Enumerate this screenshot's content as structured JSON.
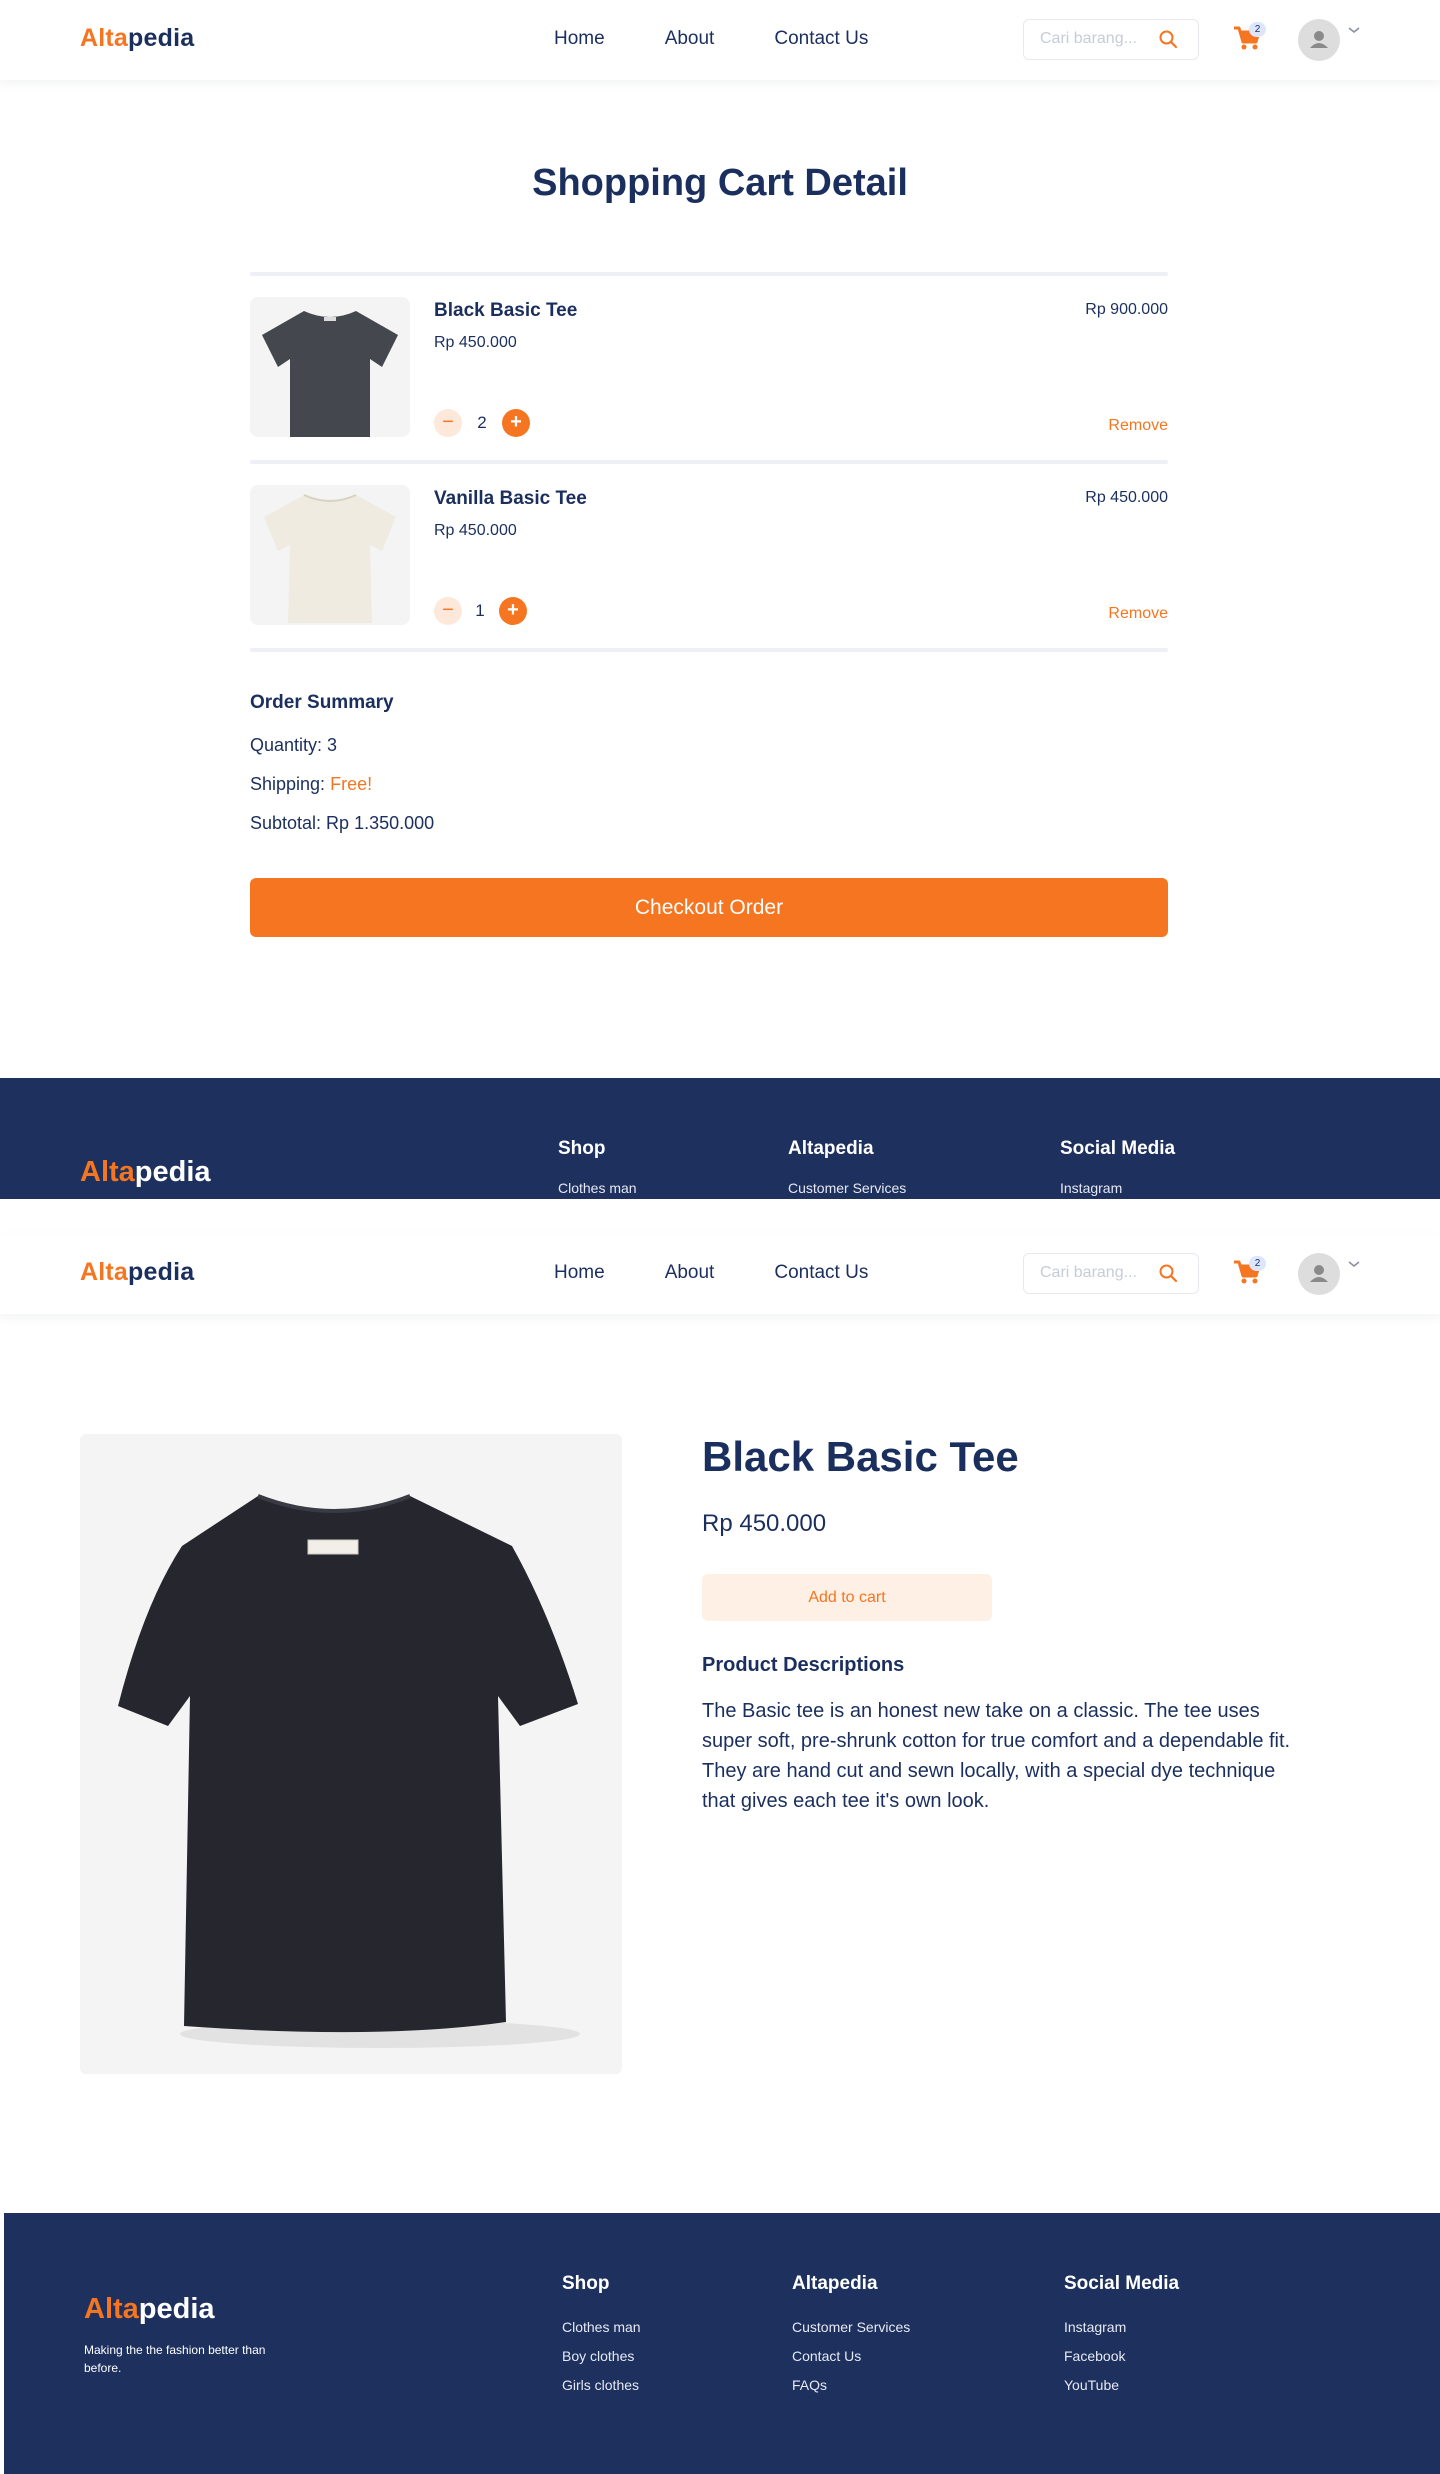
{
  "brand": {
    "part1": "Alta",
    "part2": "pedia"
  },
  "nav": {
    "home": "Home",
    "about": "About",
    "contact": "Contact Us"
  },
  "search": {
    "placeholder": "Cari barang..."
  },
  "cart_badge": "2",
  "cart_page": {
    "title": "Shopping Cart Detail",
    "items": [
      {
        "name": "Black Basic Tee",
        "price": "Rp 450.000",
        "quantity": "2",
        "total": "Rp 900.000",
        "remove": "Remove",
        "shirt_color": "#45474f"
      },
      {
        "name": "Vanilla Basic Tee",
        "price": "Rp 450.000",
        "quantity": "1",
        "total": "Rp 450.000",
        "remove": "Remove",
        "shirt_color": "#efebe0"
      }
    ],
    "summary": {
      "title": "Order Summary",
      "quantity_label": "Quantity: 3",
      "shipping_label": "Shipping:",
      "shipping_value": "Free!",
      "subtotal_label": "Subtotal: Rp 1.350.000"
    },
    "checkout": "Checkout Order"
  },
  "product_page": {
    "name": "Black Basic Tee",
    "price": "Rp 450.000",
    "add_to_cart": "Add to cart",
    "desc_title": "Product Descriptions",
    "description": "The Basic tee is an honest new take on a classic. The tee uses super soft, pre-shrunk cotton for true comfort and a dependable fit. They are hand cut and sewn locally, with a special dye technique that gives each tee it's own look.",
    "shirt_color": "#26262e"
  },
  "footer": {
    "tagline": "Making the the fashion better than before.",
    "shop": {
      "title": "Shop",
      "links": [
        "Clothes man",
        "Boy clothes",
        "Girls clothes"
      ]
    },
    "altapedia": {
      "title": "Altapedia",
      "links": [
        "Customer Services",
        "Contact Us",
        "FAQs"
      ]
    },
    "social": {
      "title": "Social Media",
      "links": [
        "Instagram",
        "Facebook",
        "YouTube"
      ]
    }
  },
  "colors": {
    "accent": "#f57520",
    "navy": "#1d305e",
    "accent_light": "#fff0e6"
  }
}
